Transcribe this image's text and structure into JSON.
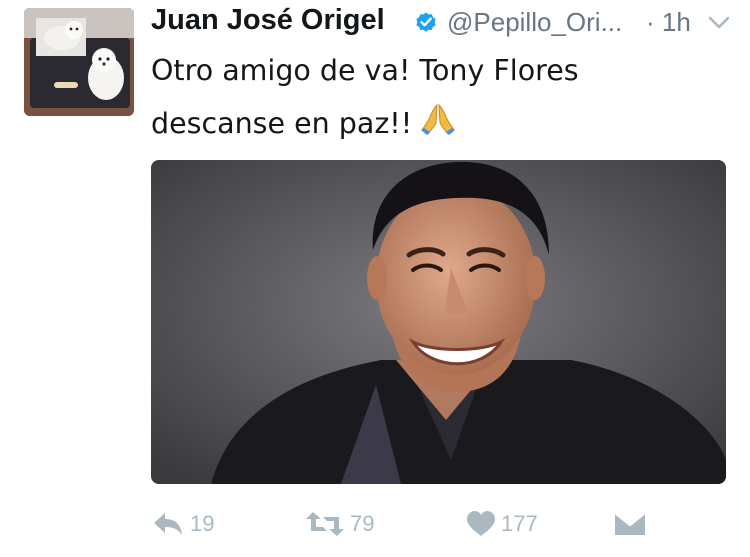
{
  "tweet": {
    "author": {
      "display_name": "Juan José Origel",
      "handle": "@Pepillo_Ori...",
      "verified": true,
      "avatar_icon": "avatar-dogs-photo"
    },
    "timestamp": "· 1h",
    "text_lines": [
      "Otro amigo de va! Tony Flores",
      "descanse en paz!!"
    ],
    "emoji": "folded-hands",
    "media": {
      "icon": "photo-smiling-man"
    },
    "actions": {
      "reply": {
        "icon": "reply-icon",
        "count": "19"
      },
      "retweet": {
        "icon": "retweet-icon",
        "count": "79"
      },
      "like": {
        "icon": "heart-icon",
        "count": "177"
      },
      "dm": {
        "icon": "envelope-icon"
      }
    }
  },
  "colors": {
    "text": "#14171a",
    "secondary": "#657786",
    "action_gray": "#aab8c2",
    "verified_blue": "#1da1f2"
  }
}
